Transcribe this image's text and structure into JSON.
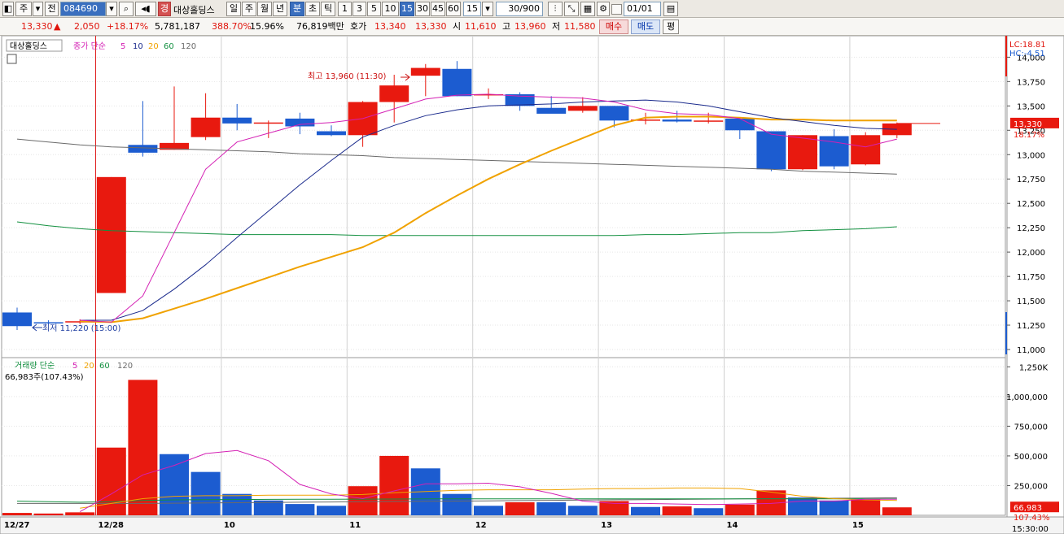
{
  "toolbar": {
    "period_type": "주",
    "prefix": "전",
    "code": "084690",
    "name_badge": "경",
    "name": "대상홀딩스",
    "periods": [
      "일",
      "주",
      "월",
      "년"
    ],
    "minute_label": "분",
    "second_label": "초",
    "tick_label": "틱",
    "intervals": [
      "1",
      "3",
      "5",
      "10",
      "15",
      "30",
      "45",
      "60"
    ],
    "selected_interval": "15",
    "interval_select": "15",
    "count": "30/900",
    "date_input": "01/01"
  },
  "quote": {
    "price": "13,330",
    "arrow": "▲",
    "change": "2,050",
    "change_pct": "+18.17%",
    "volume": "5,781,187",
    "vol_ratio": "388.70%",
    "turnover": "15.96%",
    "amount": "76,819백만",
    "ask_label": "호가",
    "ask": "13,340",
    "bid": "13,330",
    "open_label": "시",
    "open": "11,610",
    "high_label": "고",
    "high": "13,960",
    "low_label": "저",
    "low": "11,580",
    "buy_button": "매수",
    "sell_button": "매도",
    "eval_button": "평"
  },
  "price_panel": {
    "name_tag": "대상홀딩스",
    "legend_label": "종가 단순",
    "legend_periods": [
      "5",
      "10",
      "20",
      "60",
      "120"
    ],
    "lc_label": "LC:18.81",
    "hc_label": "HC:-4.51",
    "current_price": "13,330",
    "current_pct": "18.17%",
    "high_annotation": "최고 13,960 (11:30)",
    "low_annotation": "최저 11,220 (15:00)"
  },
  "volume_panel": {
    "legend_label": "거래량 단순",
    "legend_periods": [
      "5",
      "20",
      "60",
      "120"
    ],
    "info": "66,983주(107.43%)",
    "current_volume": "66,983",
    "current_pct": "107.43%"
  },
  "time_axis": {
    "date_labels": [
      "12/27",
      "12/28",
      "10",
      "11",
      "12",
      "13",
      "14",
      "15"
    ],
    "end_time": "15:30:00"
  },
  "colors": {
    "up": "#e8190f",
    "down": "#1c5cd0",
    "ma5": "#d420b4",
    "ma10": "#1a2a8c",
    "ma20": "#f0a200",
    "ma60": "#139040",
    "ma120": "#6a6a6a"
  },
  "chart_data": [
    {
      "type": "candlestick",
      "title": "",
      "ylim": [
        10950,
        14170
      ],
      "yticks": [
        11000,
        11250,
        11500,
        11750,
        12000,
        12250,
        12500,
        12750,
        13000,
        13250,
        13500,
        13750,
        14000
      ],
      "ytick_labels": [
        "11,000",
        "11,250",
        "11,500",
        "11,750",
        "12,000",
        "12,250",
        "12,500",
        "12,750",
        "13,000",
        "13,250",
        "13,500",
        "13,750",
        "14,000"
      ],
      "candles": [
        {
          "o": 11380,
          "h": 11430,
          "l": 11200,
          "c": 11240
        },
        {
          "o": 11280,
          "h": 11300,
          "l": 11260,
          "c": 11270
        },
        {
          "o": 11280,
          "h": 11310,
          "l": 11260,
          "c": 11290
        },
        {
          "o": 11580,
          "h": 12770,
          "l": 11580,
          "c": 12770
        },
        {
          "o": 13100,
          "h": 13550,
          "l": 12980,
          "c": 13020
        },
        {
          "o": 13050,
          "h": 13700,
          "l": 13050,
          "c": 13120
        },
        {
          "o": 13180,
          "h": 13630,
          "l": 13150,
          "c": 13380
        },
        {
          "o": 13380,
          "h": 13520,
          "l": 13250,
          "c": 13320
        },
        {
          "o": 13330,
          "h": 13350,
          "l": 13170,
          "c": 13330
        },
        {
          "o": 13370,
          "h": 13430,
          "l": 13210,
          "c": 13290
        },
        {
          "o": 13240,
          "h": 13300,
          "l": 13190,
          "c": 13200
        },
        {
          "o": 13200,
          "h": 13550,
          "l": 13080,
          "c": 13540
        },
        {
          "o": 13540,
          "h": 13820,
          "l": 13330,
          "c": 13710
        },
        {
          "o": 13810,
          "h": 13930,
          "l": 13600,
          "c": 13890
        },
        {
          "o": 13880,
          "h": 13960,
          "l": 13600,
          "c": 13600
        },
        {
          "o": 13610,
          "h": 13680,
          "l": 13570,
          "c": 13620
        },
        {
          "o": 13620,
          "h": 13640,
          "l": 13450,
          "c": 13500
        },
        {
          "o": 13480,
          "h": 13600,
          "l": 13450,
          "c": 13420
        },
        {
          "o": 13450,
          "h": 13590,
          "l": 13430,
          "c": 13500
        },
        {
          "o": 13500,
          "h": 13500,
          "l": 13280,
          "c": 13350
        },
        {
          "o": 13350,
          "h": 13430,
          "l": 13310,
          "c": 13360
        },
        {
          "o": 13360,
          "h": 13450,
          "l": 13330,
          "c": 13340
        },
        {
          "o": 13340,
          "h": 13430,
          "l": 13320,
          "c": 13350
        },
        {
          "o": 13370,
          "h": 13380,
          "l": 13160,
          "c": 13250
        },
        {
          "o": 13240,
          "h": 13240,
          "l": 12830,
          "c": 12850
        },
        {
          "o": 12850,
          "h": 13200,
          "l": 12840,
          "c": 13200
        },
        {
          "o": 13190,
          "h": 13260,
          "l": 12850,
          "c": 12880
        },
        {
          "o": 12900,
          "h": 13230,
          "l": 12890,
          "c": 13200
        },
        {
          "o": 13200,
          "h": 13330,
          "l": 13170,
          "c": 13320
        }
      ],
      "ma5": [
        null,
        null,
        11300,
        11280,
        11550,
        12200,
        12850,
        13130,
        13220,
        13310,
        13330,
        13370,
        13470,
        13570,
        13610,
        13620,
        13600,
        13590,
        13580,
        13540,
        13460,
        13420,
        13410,
        13370,
        13210,
        13170,
        13130,
        13080,
        13160
      ],
      "ma10": [
        null,
        null,
        11300,
        11300,
        11400,
        11620,
        11870,
        12150,
        12420,
        12690,
        12940,
        13180,
        13300,
        13400,
        13460,
        13500,
        13510,
        13520,
        13540,
        13550,
        13560,
        13540,
        13500,
        13440,
        13380,
        13340,
        13300,
        13270,
        13260
      ],
      "ma20": [
        null,
        null,
        11290,
        11280,
        11320,
        11420,
        11520,
        11630,
        11740,
        11850,
        11950,
        12050,
        12200,
        12400,
        12580,
        12750,
        12900,
        13040,
        13170,
        13300,
        13380,
        13390,
        13390,
        13380,
        13360,
        13360,
        13350,
        13350,
        13350
      ],
      "ma60": [
        12310,
        12270,
        12240,
        12220,
        12210,
        12200,
        12190,
        12180,
        12180,
        12180,
        12180,
        12170,
        12170,
        12170,
        12170,
        12170,
        12170,
        12170,
        12170,
        12170,
        12180,
        12180,
        12190,
        12200,
        12200,
        12220,
        12230,
        12240,
        12260
      ],
      "ma120": [
        13160,
        13130,
        13100,
        13080,
        13070,
        13060,
        13050,
        13040,
        13030,
        13010,
        13000,
        12990,
        12970,
        12960,
        12950,
        12940,
        12930,
        12920,
        12910,
        12900,
        12890,
        12880,
        12870,
        12860,
        12850,
        12830,
        12820,
        12810,
        12800
      ]
    },
    {
      "type": "bar",
      "title": "",
      "ylim": [
        0,
        1300000
      ],
      "yticks": [
        250000,
        500000,
        750000,
        1000000,
        1250000
      ],
      "ytick_labels": [
        "250,000",
        "500,000",
        "750,000",
        "1,000,000",
        "1,250K"
      ],
      "volumes": [
        20000,
        15000,
        25000,
        570000,
        1140000,
        515000,
        365000,
        180000,
        125000,
        95000,
        80000,
        245000,
        500000,
        395000,
        180000,
        80000,
        110000,
        110000,
        80000,
        120000,
        70000,
        75000,
        60000,
        90000,
        210000,
        150000,
        125000,
        140000,
        66983
      ],
      "up_flags": [
        true,
        true,
        true,
        true,
        true,
        false,
        false,
        false,
        false,
        false,
        false,
        true,
        true,
        false,
        false,
        false,
        true,
        false,
        false,
        true,
        false,
        true,
        false,
        true,
        true,
        false,
        false,
        true,
        true
      ],
      "ma5": [
        null,
        null,
        30000,
        180000,
        340000,
        420000,
        520000,
        545000,
        460000,
        260000,
        180000,
        140000,
        205000,
        265000,
        265000,
        270000,
        240000,
        185000,
        120000,
        100000,
        100000,
        95000,
        90000,
        95000,
        100000,
        120000,
        120000,
        135000,
        135000
      ],
      "ma20": [
        null,
        null,
        60000,
        100000,
        140000,
        160000,
        165000,
        165000,
        170000,
        170000,
        170000,
        175000,
        190000,
        200000,
        210000,
        215000,
        215000,
        215000,
        220000,
        225000,
        225000,
        230000,
        230000,
        225000,
        195000,
        160000,
        140000,
        130000,
        125000
      ],
      "ma60": [
        120000,
        115000,
        110000,
        115000,
        125000,
        130000,
        132000,
        133000,
        134000,
        135000,
        135000,
        136000,
        137000,
        138000,
        138000,
        138000,
        138000,
        138000,
        138000,
        138000,
        138000,
        138000,
        138000,
        138000,
        138000,
        138000,
        138000,
        138000,
        138000
      ],
      "ma120": [
        100000,
        100000,
        100000,
        100000,
        100000,
        102000,
        104000,
        106000,
        108000,
        110000,
        112000,
        114000,
        116000,
        118000,
        120000,
        122000,
        124000,
        126000,
        128000,
        130000,
        132000,
        134000,
        136000,
        138000,
        140000,
        142000,
        144000,
        146000,
        148000
      ]
    }
  ]
}
